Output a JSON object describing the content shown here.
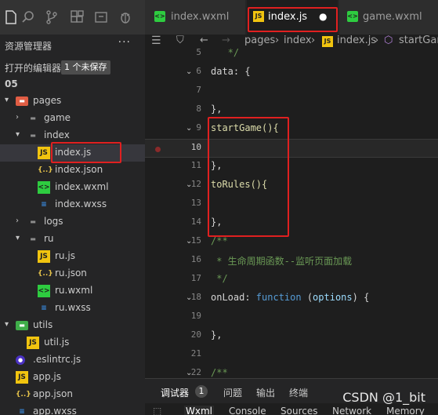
{
  "activity_icons": [
    "files-icon",
    "search-icon",
    "source-control-icon",
    "extensions-icon",
    "package-icon",
    "debug-icon"
  ],
  "sidebar": {
    "title": "资源管理器",
    "more": "···",
    "open_editors_label": "打开的编辑器",
    "unsaved_badge": "1 个未保存",
    "project": "05",
    "tree": [
      {
        "label": "pages",
        "kind": "folder-pages",
        "expanded": true,
        "depth": 0
      },
      {
        "label": "game",
        "kind": "folder",
        "expanded": false,
        "depth": 1
      },
      {
        "label": "index",
        "kind": "folder",
        "expanded": true,
        "depth": 1
      },
      {
        "label": "index.js",
        "kind": "js",
        "depth": 2,
        "selected": true
      },
      {
        "label": "index.json",
        "kind": "json",
        "depth": 2
      },
      {
        "label": "index.wxml",
        "kind": "wxml",
        "depth": 2
      },
      {
        "label": "index.wxss",
        "kind": "wxss",
        "depth": 2
      },
      {
        "label": "logs",
        "kind": "folder",
        "expanded": false,
        "depth": 1
      },
      {
        "label": "ru",
        "kind": "folder",
        "expanded": true,
        "depth": 1
      },
      {
        "label": "ru.js",
        "kind": "js",
        "depth": 2
      },
      {
        "label": "ru.json",
        "kind": "json",
        "depth": 2
      },
      {
        "label": "ru.wxml",
        "kind": "wxml",
        "depth": 2
      },
      {
        "label": "ru.wxss",
        "kind": "wxss",
        "depth": 2
      },
      {
        "label": "utils",
        "kind": "folder-utils",
        "expanded": true,
        "depth": 0
      },
      {
        "label": "util.js",
        "kind": "js",
        "depth": 1
      },
      {
        "label": ".eslintrc.js",
        "kind": "eslint",
        "depth": 0
      },
      {
        "label": "app.js",
        "kind": "js",
        "depth": 0
      },
      {
        "label": "app.json",
        "kind": "json",
        "depth": 0
      },
      {
        "label": "app.wxss",
        "kind": "wxss",
        "depth": 0
      }
    ]
  },
  "tabs": [
    {
      "label": "index.wxml",
      "kind": "wxml",
      "active": false
    },
    {
      "label": "index.js",
      "kind": "js",
      "active": true,
      "dirty": "●"
    },
    {
      "label": "game.wxml",
      "kind": "wxml",
      "active": false
    }
  ],
  "breadcrumb": [
    "pages",
    "index",
    "index.js",
    "startGame"
  ],
  "editor": {
    "lines": [
      {
        "n": "5",
        "text": "   */",
        "cls": "comment"
      },
      {
        "n": "6",
        "text": "data: {",
        "cls": "plain",
        "fold": true
      },
      {
        "n": "7",
        "text": "",
        "cls": "plain"
      },
      {
        "n": "8",
        "text": "},",
        "cls": "plain"
      },
      {
        "n": "9",
        "text": "startGame(){",
        "cls": "fn",
        "fold": true
      },
      {
        "n": "10",
        "text": "",
        "cls": "plain",
        "current": true,
        "breakpoint": true
      },
      {
        "n": "11",
        "text": "},",
        "cls": "plain"
      },
      {
        "n": "12",
        "text": "toRules(){",
        "cls": "fn",
        "fold": true
      },
      {
        "n": "13",
        "text": "",
        "cls": "plain"
      },
      {
        "n": "14",
        "text": "},",
        "cls": "plain"
      },
      {
        "n": "15",
        "text": "/**",
        "cls": "comment",
        "fold": true
      },
      {
        "n": "16",
        "text": " * 生命周期函数--监听页面加载",
        "cls": "comment"
      },
      {
        "n": "17",
        "text": " */",
        "cls": "comment"
      },
      {
        "n": "18",
        "text": "onLoad: function (options) {",
        "cls": "onload",
        "fold": true
      },
      {
        "n": "19",
        "text": "",
        "cls": "plain"
      },
      {
        "n": "20",
        "text": "},",
        "cls": "plain"
      },
      {
        "n": "21",
        "text": "",
        "cls": "plain"
      },
      {
        "n": "22",
        "text": "/**",
        "cls": "comment",
        "fold": true
      }
    ]
  },
  "panel": {
    "tabs": [
      "调试器",
      "问题",
      "输出",
      "终端"
    ],
    "badge": "1",
    "devtools_tabs": [
      "Wxml",
      "Console",
      "Sources",
      "Network",
      "Memory"
    ]
  },
  "watermark": "CSDN @1_bit",
  "colors": {
    "accent_red": "#e02020",
    "js_icon": "#f1c40f",
    "wxml_icon": "#2ecc40",
    "wxss_icon": "#3a8ee6",
    "json_icon": "#e6c34a",
    "folder": "#8c8c8c"
  }
}
